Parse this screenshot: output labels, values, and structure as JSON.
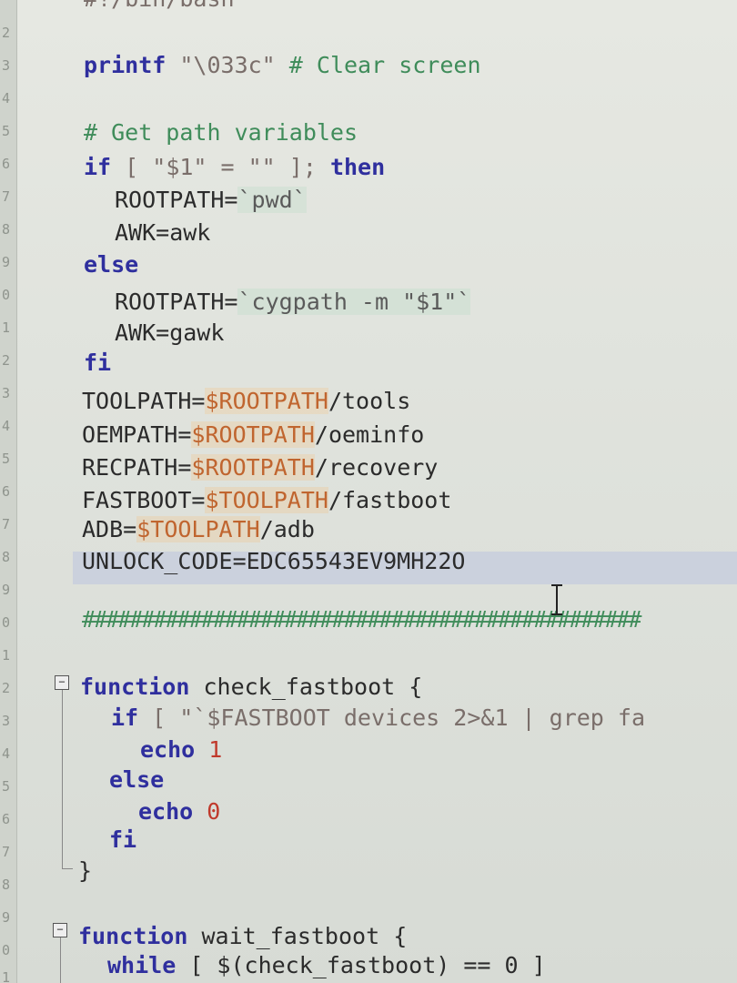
{
  "colors": {
    "keyword": "#2f2f9e",
    "comment": "#3f8c5a",
    "variable": "#c0652f",
    "number": "#c0392b",
    "background": "#e2e4de"
  },
  "gutter": {
    "line_numbers": [
      "2",
      "3",
      "4",
      "5",
      "6",
      "7",
      "8",
      "9",
      "0",
      "1",
      "2",
      "3",
      "4",
      "5",
      "6",
      "7",
      "8",
      "9",
      "0",
      "1",
      "2",
      "3",
      "4",
      "5",
      "6",
      "7",
      "8",
      "9",
      "0",
      "1"
    ]
  },
  "code": {
    "l0": "#!/bin/bash",
    "l1_kw": "printf",
    "l1_str": " \"\\033c\"",
    "l1_cm": " # Clear screen",
    "l2": "# Get path variables",
    "l3_kw1": "if",
    "l3_mid": " [ \"$1\" = \"\" ];",
    "l3_kw2": " then",
    "l4_a": "ROOTPATH=",
    "l4_b": "`pwd`",
    "l5": "AWK=awk",
    "l6": "else",
    "l7_a": "ROOTPATH=",
    "l7_b": "`cygpath -m \"$1\"`",
    "l8": "AWK=gawk",
    "l9": "fi",
    "l10_a": "TOOLPATH=",
    "l10_v": "$ROOTPATH",
    "l10_b": "/tools",
    "l11_a": "OEMPATH=",
    "l11_v": "$ROOTPATH",
    "l11_b": "/oeminfo",
    "l12_a": "RECPATH=",
    "l12_v": "$ROOTPATH",
    "l12_b": "/recovery",
    "l13_a": "FASTBOOT=",
    "l13_v": "$TOOLPATH",
    "l13_b": "/fastboot",
    "l14_a": "ADB=",
    "l14_v": "$TOOLPATH",
    "l14_b": "/adb",
    "l15": "UNLOCK_CODE=EDC65543EV9MH22O",
    "l16": "###############################################",
    "l17_kw": "function",
    "l17_b": " check_fastboot {",
    "l18_kw": "if",
    "l18_b": " [ \"`$FASTBOOT devices 2>&1 | grep fa",
    "l19_kw": "echo",
    "l19_n": " 1",
    "l20": "else",
    "l21_kw": "echo",
    "l21_n": " 0",
    "l22": "fi",
    "l23": "}",
    "l24_kw": "function",
    "l24_b": " wait_fastboot {",
    "l25_kw": "while",
    "l25_b": " [ $(check_fastboot) == 0 ]"
  }
}
